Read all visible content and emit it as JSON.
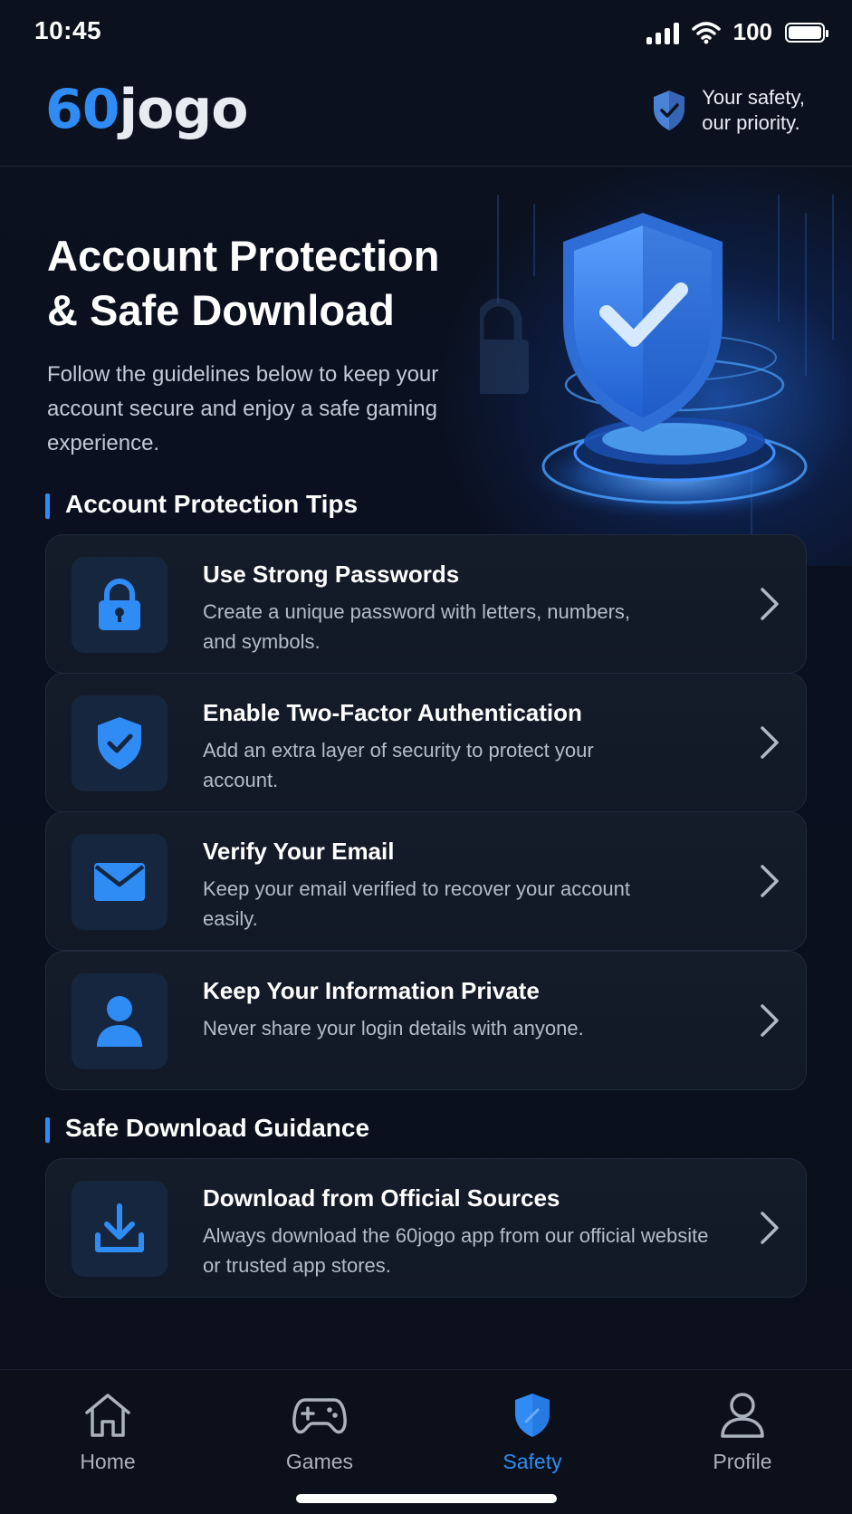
{
  "status_bar": {
    "time": "10:45",
    "battery": "100"
  },
  "header": {
    "logo_accent": "60",
    "logo_rest": "jogo",
    "safety_line1": "Your safety,",
    "safety_line2": "our priority."
  },
  "hero": {
    "title_line1": "Account Protection",
    "title_line2": "& Safe Download",
    "subtitle": "Follow the guidelines below to keep your account secure and enjoy a safe gaming experience."
  },
  "sections": {
    "protection_title": "Account Protection Tips",
    "download_title": "Safe Download Guidance"
  },
  "tips": [
    {
      "title": "Use Strong Passwords",
      "desc": "Create a unique password with letters, numbers, and symbols.",
      "icon": "lock-icon"
    },
    {
      "title": "Enable Two-Factor Authentication",
      "desc": "Add an extra layer of security to protect your account.",
      "icon": "shield-check-icon"
    },
    {
      "title": "Verify Your Email",
      "desc": "Keep your email verified to recover your account easily.",
      "icon": "mail-icon"
    },
    {
      "title": "Keep Your Information Private",
      "desc": "Never share your login details with anyone.",
      "icon": "user-icon"
    }
  ],
  "download": [
    {
      "title": "Download from Official Sources",
      "desc": "Always download the 60jogo app from our official website or trusted app stores.",
      "icon": "download-icon"
    }
  ],
  "nav": {
    "home": "Home",
    "games": "Games",
    "safety": "Safety",
    "profile": "Profile",
    "active": "safety"
  },
  "colors": {
    "accent": "#2f8cf5",
    "background": "#0a0f1a",
    "card": "#141c2a"
  }
}
